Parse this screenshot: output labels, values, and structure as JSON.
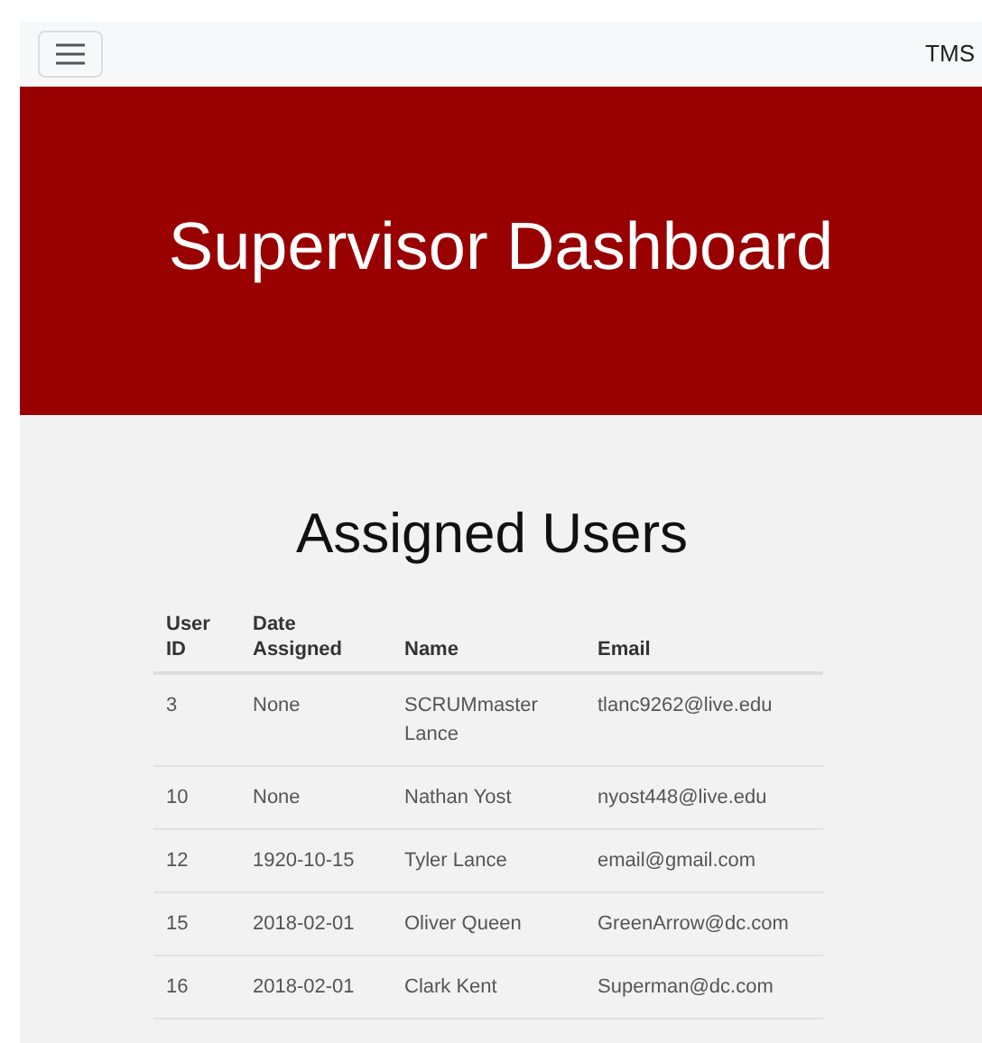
{
  "navbar": {
    "brand": "TMS"
  },
  "banner": {
    "title": "Supervisor Dashboard"
  },
  "section": {
    "title": "Assigned Users"
  },
  "table": {
    "columns": [
      "User ID",
      "Date Assigned",
      "Name",
      "Email"
    ],
    "rows": [
      [
        "3",
        "None",
        "SCRUMmaster Lance",
        "tlanc9262@live.edu"
      ],
      [
        "10",
        "None",
        "Nathan Yost",
        "nyost448@live.edu"
      ],
      [
        "12",
        "1920-10-15",
        "Tyler Lance",
        "email@gmail.com"
      ],
      [
        "15",
        "2018-02-01",
        "Oliver Queen",
        "GreenArrow@dc.com"
      ],
      [
        "16",
        "2018-02-01",
        "Clark Kent",
        "Superman@dc.com"
      ]
    ]
  }
}
